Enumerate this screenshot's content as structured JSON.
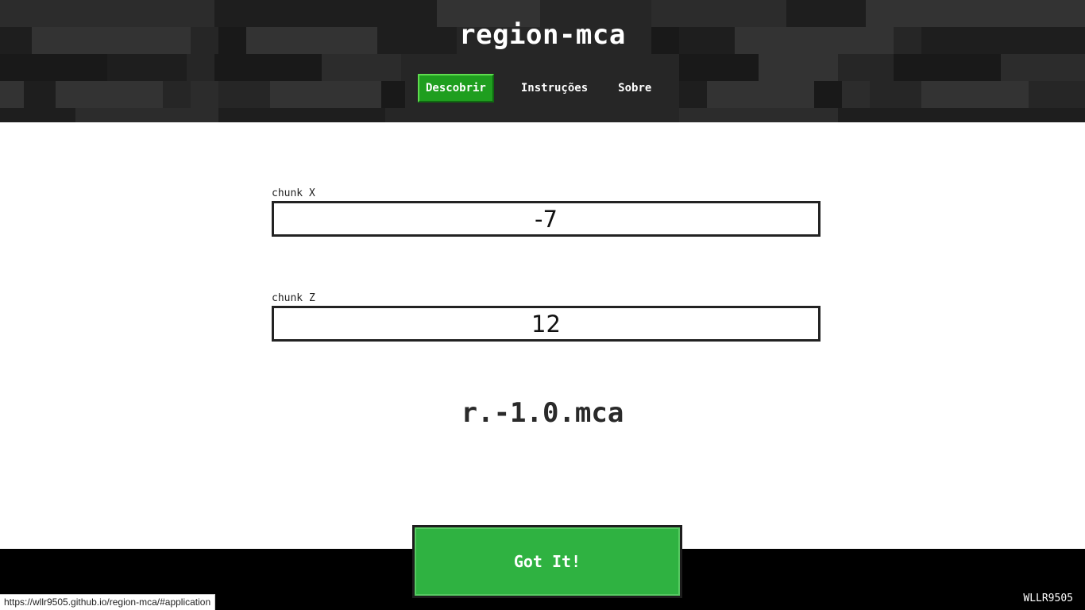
{
  "header": {
    "title": "region-mca",
    "nav": [
      {
        "label": "Descobrir",
        "active": true
      },
      {
        "label": "Instruções",
        "active": false
      },
      {
        "label": "Sobre",
        "active": false
      }
    ]
  },
  "form": {
    "chunk_x": {
      "label": "chunk X",
      "value": "-7"
    },
    "chunk_z": {
      "label": "chunk Z",
      "value": "12"
    }
  },
  "result": {
    "filename": "r.-1.0.mca"
  },
  "cookie_banner": {
    "button_label": "Got It!"
  },
  "footer": {
    "credit": "WLLR9505"
  },
  "status_bar": {
    "url": "https://wllr9505.github.io/region-mca/#application"
  },
  "colors": {
    "accent_green": "#1f9e1f",
    "button_green": "#2fb241",
    "header_bg": "#262626",
    "footer_bg": "#000000"
  }
}
